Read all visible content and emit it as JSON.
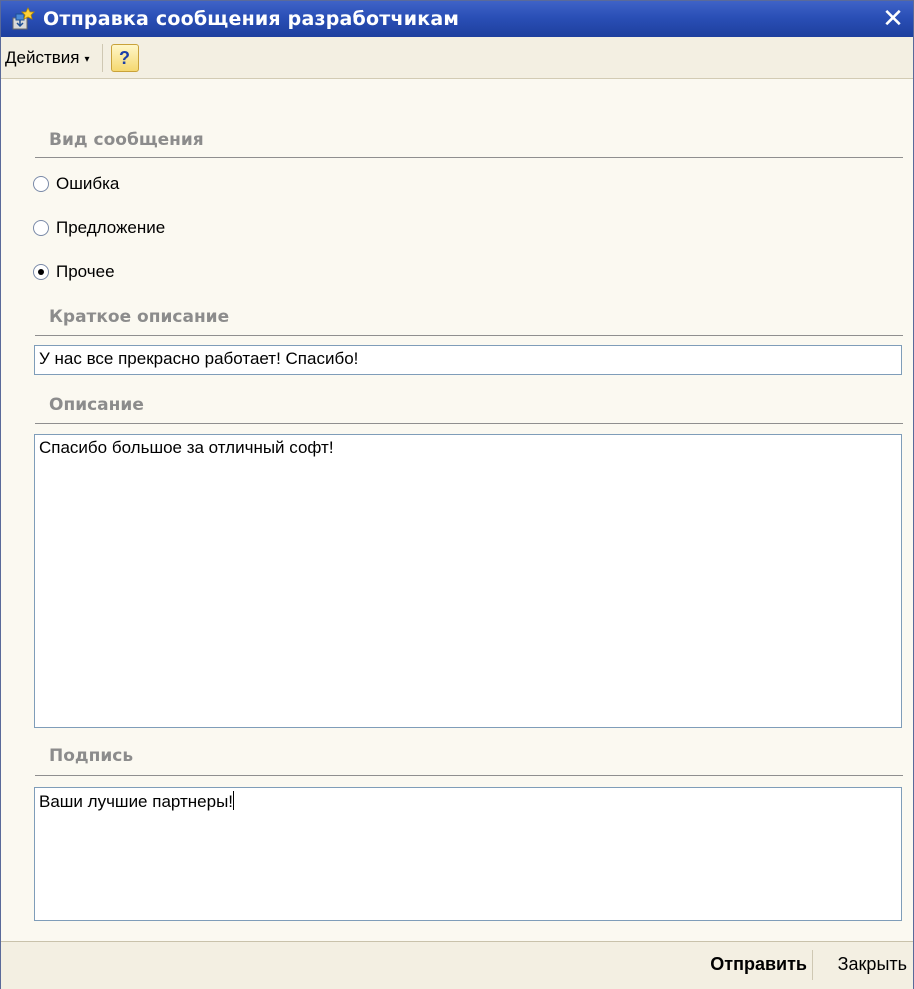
{
  "window": {
    "title": "Отправка сообщения разработчикам",
    "close_glyph": "✕",
    "title_icon": "app-icon"
  },
  "toolbar": {
    "actions_label": "Действия",
    "actions_arrow": "▾",
    "help_label": "?"
  },
  "message_type": {
    "label": "Вид сообщения",
    "options": [
      {
        "label": "Ошибка",
        "checked": false
      },
      {
        "label": "Предложение",
        "checked": false
      },
      {
        "label": "Прочее",
        "checked": true
      }
    ]
  },
  "short_description": {
    "label": "Краткое описание",
    "value": "У нас все прекрасно работает! Спасибо!"
  },
  "description": {
    "label": "Описание",
    "value": "Спасибо большое за отличный софт!"
  },
  "signature": {
    "label": "Подпись",
    "value": "Ваши лучшие партнеры!"
  },
  "footer": {
    "send_label": "Отправить",
    "close_label": "Закрыть"
  }
}
